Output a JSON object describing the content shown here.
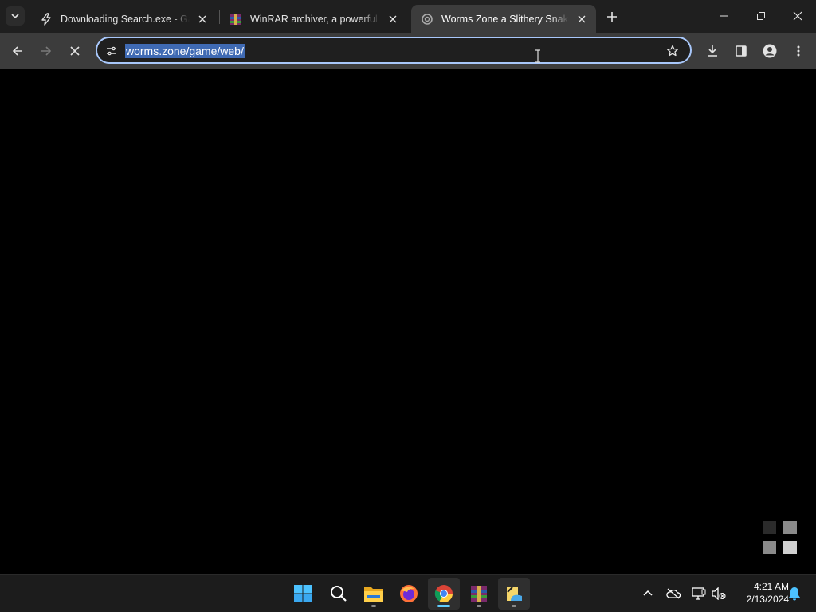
{
  "browser": {
    "tabs": [
      {
        "title": "Downloading Search.exe - Gam",
        "favicon": "bolt-icon",
        "active": false
      },
      {
        "title": "WinRAR archiver, a powerful to",
        "favicon": "winrar-icon",
        "active": false
      },
      {
        "title": "Worms Zone a Slithery Snake",
        "favicon": "globe-spinner-icon",
        "active": true
      }
    ],
    "address": "worms.zone/game/web/"
  },
  "taskbar": {
    "apps": [
      "start-icon",
      "search-icon",
      "file-explorer-icon",
      "firefox-icon",
      "chrome-icon",
      "winrar-icon",
      "paint-icon"
    ],
    "clock": {
      "time": "4:21 AM",
      "date": "2/13/2024"
    }
  },
  "colors": {
    "accent": "#a8c7fa",
    "selection": "#3f6ab3",
    "taskbar_indicator": "#60cdff"
  }
}
